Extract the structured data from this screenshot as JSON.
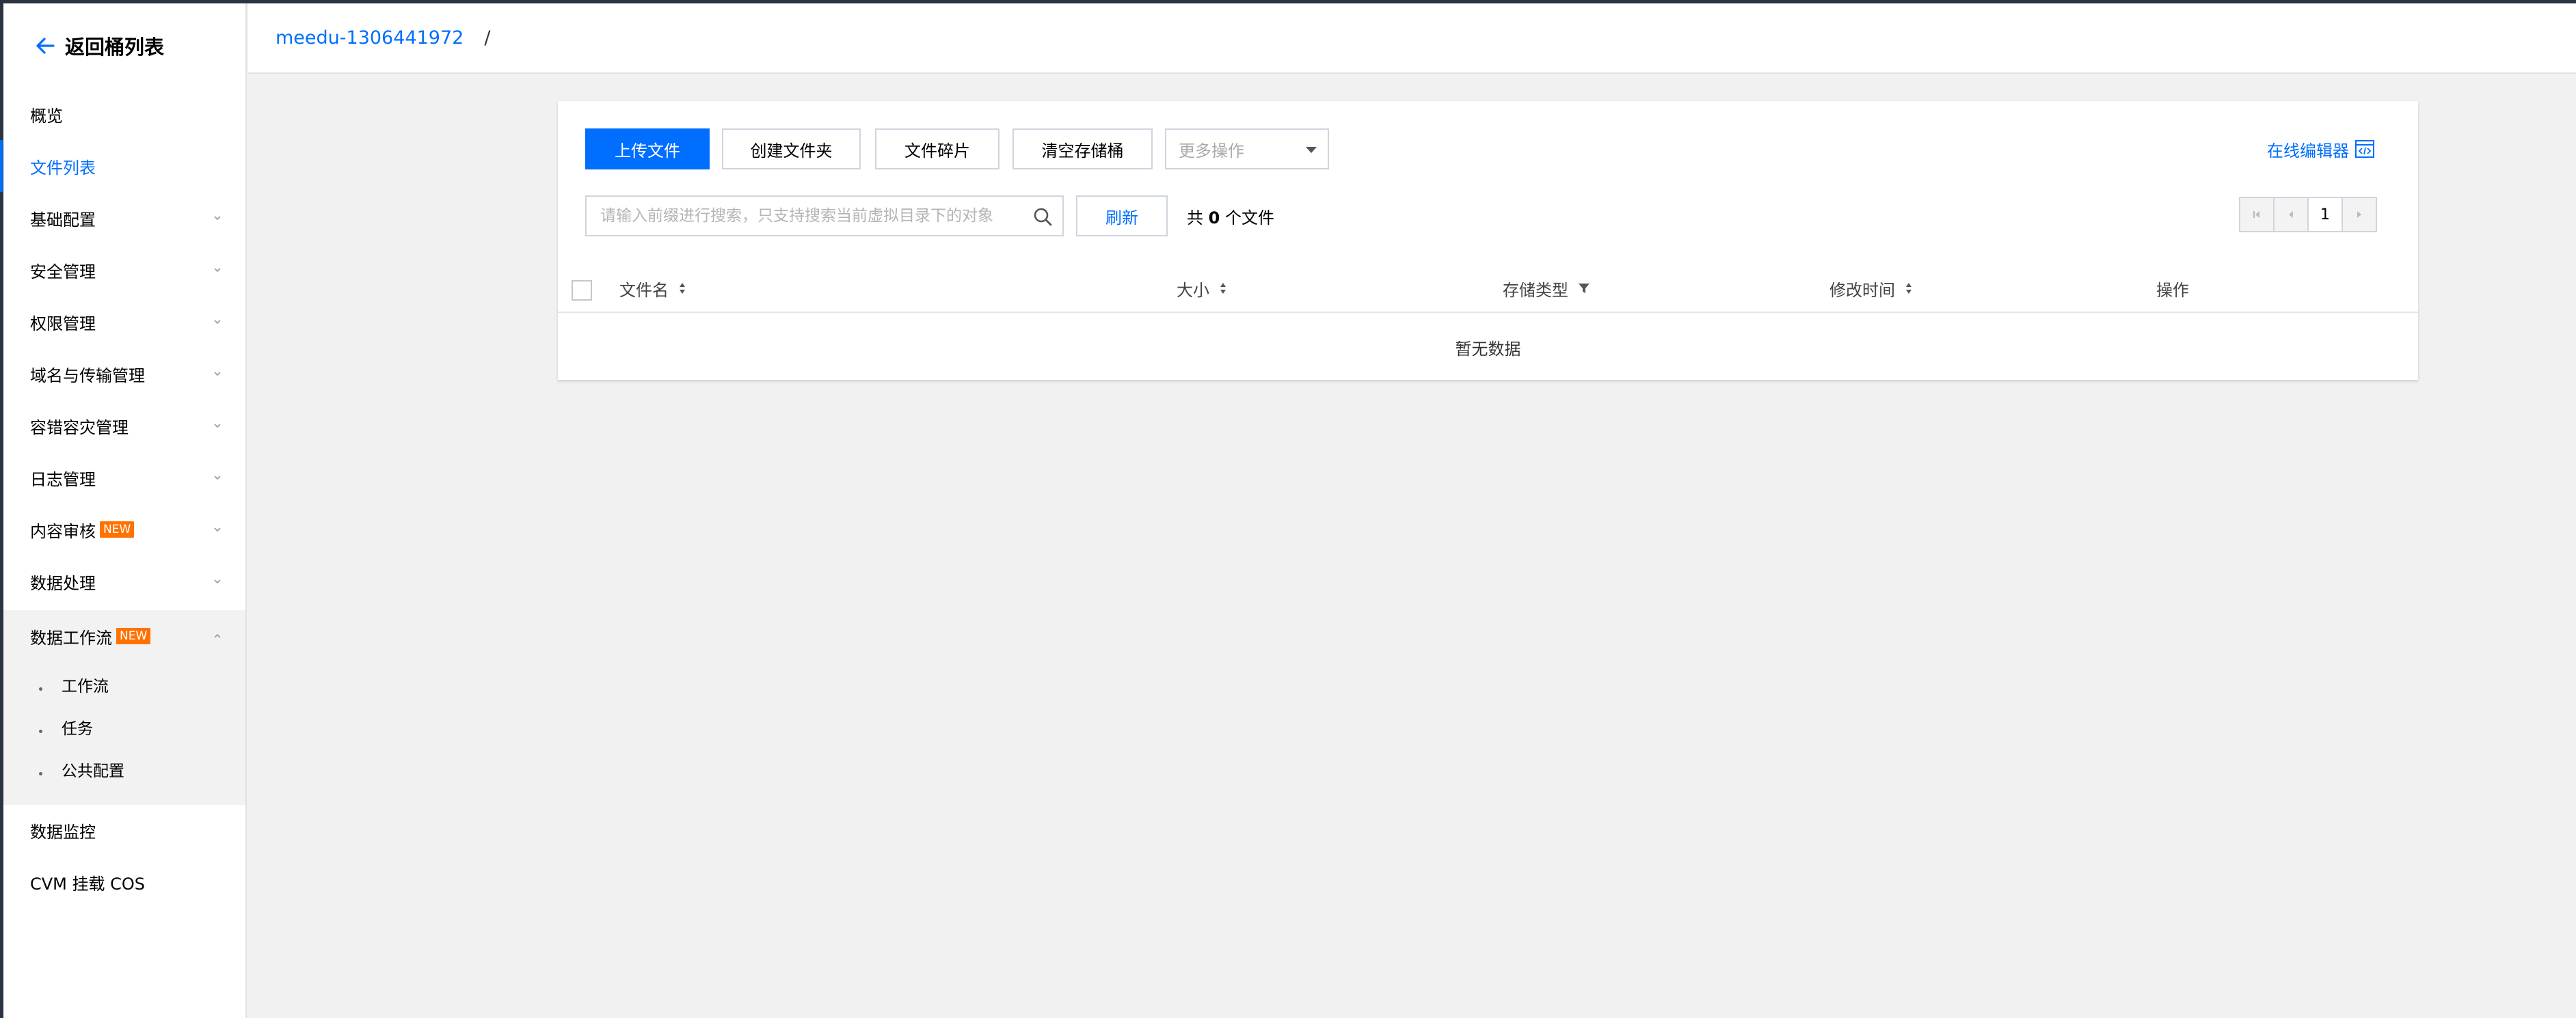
{
  "sidebar": {
    "back_label": "返回桶列表",
    "items": [
      {
        "label": "概览",
        "has_chevron": false
      },
      {
        "label": "文件列表",
        "has_chevron": false
      },
      {
        "label": "基础配置",
        "has_chevron": true
      },
      {
        "label": "安全管理",
        "has_chevron": true
      },
      {
        "label": "权限管理",
        "has_chevron": true
      },
      {
        "label": "域名与传输管理",
        "has_chevron": true
      },
      {
        "label": "容错容灾管理",
        "has_chevron": true
      },
      {
        "label": "日志管理",
        "has_chevron": true
      },
      {
        "label": "内容审核",
        "badge": "NEW",
        "has_chevron": true
      },
      {
        "label": "数据处理",
        "has_chevron": true
      },
      {
        "label": "数据工作流",
        "badge": "NEW",
        "has_chevron": true,
        "expanded": true
      },
      {
        "label": "数据监控",
        "has_chevron": false
      },
      {
        "label": "CVM 挂载 COS",
        "has_chevron": false
      }
    ],
    "active_item": "文件列表",
    "sub_items": [
      "工作流",
      "任务",
      "公共配置"
    ]
  },
  "breadcrumb": {
    "bucket": "meedu-1306441972",
    "separator": "/"
  },
  "toolbar": {
    "upload_label": "上传文件",
    "create_folder_label": "创建文件夹",
    "fragments_label": "文件碎片",
    "clear_bucket_label": "清空存储桶",
    "more_actions_placeholder": "更多操作",
    "online_editor_label": "在线编辑器"
  },
  "search": {
    "placeholder": "请输入前缀进行搜索，只支持搜索当前虚拟目录下的对象",
    "value": "",
    "refresh_label": "刷新",
    "count_prefix": "共",
    "count_value": "0",
    "count_suffix": "个文件"
  },
  "pagination": {
    "current_page": "1"
  },
  "table": {
    "columns": [
      "文件名",
      "大小",
      "存储类型",
      "修改时间",
      "操作"
    ],
    "empty_text": "暂无数据"
  },
  "colors": {
    "accent": "#006eff",
    "badge": "#ff7200",
    "background": "#f1f1f1"
  }
}
